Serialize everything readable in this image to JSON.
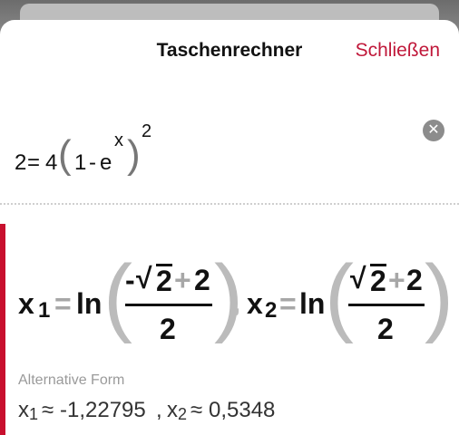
{
  "header": {
    "title": "Taschenrechner",
    "close_label": "Schließen"
  },
  "input": {
    "lhs": "2",
    "equals": "=",
    "coef": "4",
    "one": "1",
    "minus": "-",
    "e": "e",
    "exp": "x",
    "outer_exp": "2"
  },
  "result": {
    "x": "x",
    "sub1": "1",
    "sub2": "2",
    "equals": "=",
    "ln": "ln",
    "num1_sign": "-",
    "sqrt_arg": "2",
    "plus": "+",
    "num_add": "2",
    "den": "2",
    "comma": ","
  },
  "alternative": {
    "label": "Alternative Form",
    "x": "x",
    "sub1": "1",
    "approx": "≈",
    "value1": "-1,22795",
    "comma": ",",
    "sub2": "2",
    "value2": "0,5348"
  },
  "colors": {
    "accent": "#c8102e",
    "close": "#c0183a"
  }
}
